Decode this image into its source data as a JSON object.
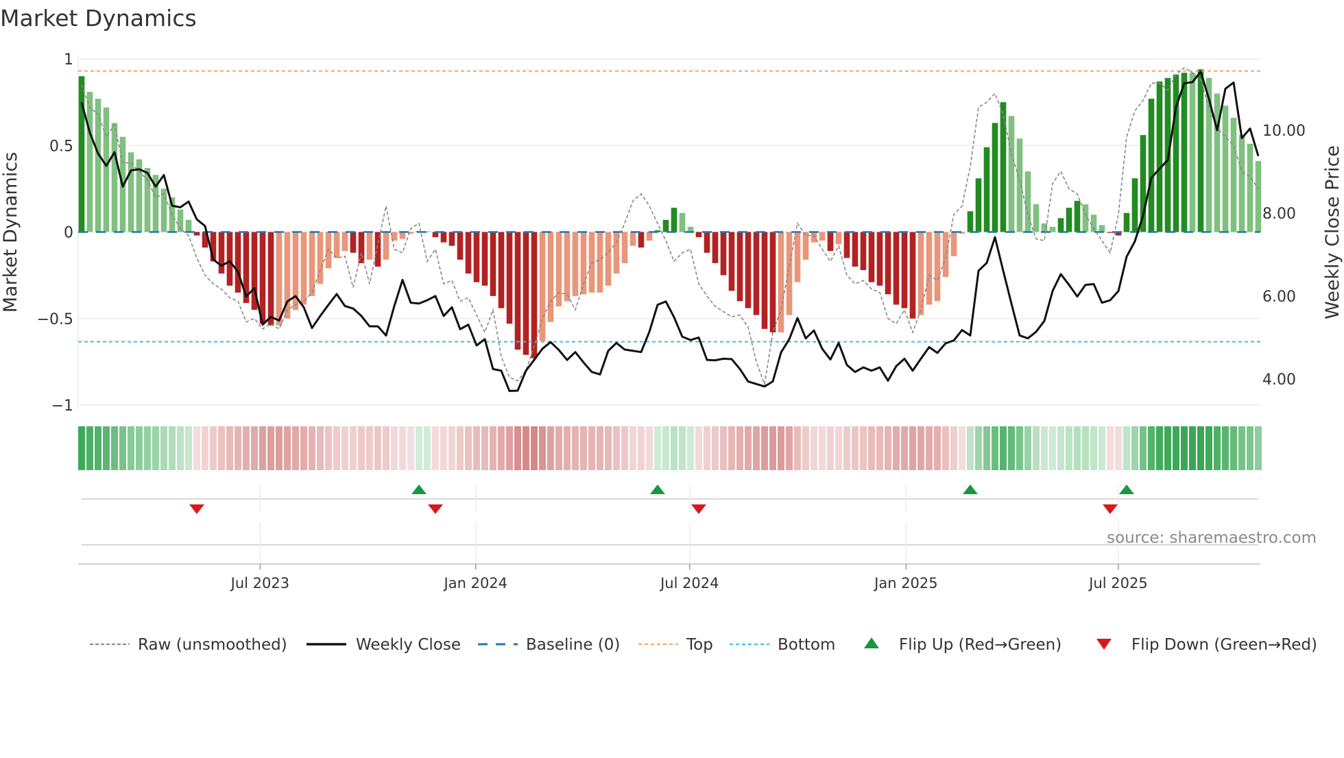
{
  "chart_data": {
    "type": "bar",
    "title": "Market Dynamics",
    "ylabel": "Market Dynamics",
    "ylabel_right": "Weekly Close Price",
    "xlabel": "",
    "ylim": [
      -1,
      1
    ],
    "ylim_right": [
      3.33,
      11.73
    ],
    "yticks": [
      {
        "v": 1,
        "label": "1"
      },
      {
        "v": 0.5,
        "label": "0.5"
      },
      {
        "v": 0,
        "label": "0"
      },
      {
        "v": -0.5,
        "label": "−0.5"
      },
      {
        "v": -1,
        "label": "−1"
      }
    ],
    "yticks_right": [
      {
        "v": 10,
        "label": "10.00"
      },
      {
        "v": 8,
        "label": "8.00"
      },
      {
        "v": 6,
        "label": "6.00"
      },
      {
        "v": 4,
        "label": "4.00"
      }
    ],
    "xticks": [
      {
        "week": 21.7,
        "label": "Jul 2023"
      },
      {
        "week": 47.9,
        "label": "Jan 2024"
      },
      {
        "week": 73.9,
        "label": "Jul 2024"
      },
      {
        "week": 100.2,
        "label": "Jan 2025"
      },
      {
        "week": 126,
        "label": "Jul 2025"
      }
    ],
    "grid": true,
    "top_level": 0.93,
    "bottom_level": -0.634,
    "baseline": 0,
    "series": [
      {
        "name": "Market Dynamics (smoothed)",
        "type": "bar",
        "values": [
          0.9,
          0.81,
          0.77,
          0.72,
          0.63,
          0.55,
          0.46,
          0.42,
          0.37,
          0.33,
          0.25,
          0.2,
          0.13,
          0.07,
          -0.02,
          -0.09,
          -0.17,
          -0.24,
          -0.31,
          -0.35,
          -0.41,
          -0.45,
          -0.53,
          -0.54,
          -0.54,
          -0.5,
          -0.45,
          -0.42,
          -0.37,
          -0.3,
          -0.21,
          -0.15,
          -0.11,
          -0.12,
          -0.18,
          -0.16,
          -0.2,
          -0.16,
          -0.05,
          -0.04,
          -0.01,
          0.005,
          0.004,
          -0.03,
          -0.06,
          -0.08,
          -0.16,
          -0.24,
          -0.29,
          -0.31,
          -0.37,
          -0.44,
          -0.53,
          -0.68,
          -0.71,
          -0.73,
          -0.63,
          -0.52,
          -0.43,
          -0.4,
          -0.37,
          -0.36,
          -0.35,
          -0.35,
          -0.31,
          -0.24,
          -0.18,
          -0.08,
          -0.09,
          -0.05,
          0.01,
          0.07,
          0.14,
          0.11,
          0.03,
          -0.03,
          -0.12,
          -0.18,
          -0.25,
          -0.34,
          -0.4,
          -0.44,
          -0.48,
          -0.56,
          -0.58,
          -0.58,
          -0.48,
          -0.29,
          -0.16,
          -0.06,
          -0.05,
          -0.11,
          -0.07,
          -0.15,
          -0.2,
          -0.22,
          -0.29,
          -0.31,
          -0.36,
          -0.42,
          -0.44,
          -0.5,
          -0.48,
          -0.42,
          -0.4,
          -0.26,
          -0.14,
          -0.01,
          0.12,
          0.31,
          0.49,
          0.63,
          0.75,
          0.67,
          0.54,
          0.35,
          0.16,
          0.05,
          0.03,
          0.08,
          0.14,
          0.18,
          0.16,
          0.1,
          0.04,
          -0.005,
          -0.02,
          0.11,
          0.31,
          0.56,
          0.77,
          0.87,
          0.89,
          0.91,
          0.92,
          0.92,
          0.94,
          0.89,
          0.8,
          0.73,
          0.66,
          0.56,
          0.51,
          0.41
        ]
      },
      {
        "name": "Raw (unsmoothed)",
        "type": "line",
        "values": [
          0.85,
          0.72,
          0.68,
          0.55,
          0.62,
          0.4,
          0.4,
          0.35,
          0.3,
          0.2,
          0.22,
          0.1,
          0.02,
          -0.02,
          -0.15,
          -0.25,
          -0.3,
          -0.33,
          -0.38,
          -0.4,
          -0.52,
          -0.5,
          -0.56,
          -0.53,
          -0.56,
          -0.45,
          -0.42,
          -0.4,
          -0.35,
          -0.22,
          -0.1,
          -0.15,
          -0.14,
          -0.32,
          -0.12,
          -0.3,
          -0.07,
          0.15,
          -0.1,
          -0.12,
          0.02,
          0.05,
          -0.17,
          -0.1,
          -0.3,
          -0.28,
          -0.4,
          -0.38,
          -0.48,
          -0.58,
          -0.45,
          -0.72,
          -0.84,
          -0.86,
          -0.8,
          -0.66,
          -0.5,
          -0.4,
          -0.35,
          -0.36,
          -0.45,
          -0.3,
          -0.18,
          -0.16,
          -0.12,
          -0.06,
          0.05,
          0.18,
          0.22,
          0.15,
          0.05,
          -0.05,
          -0.17,
          -0.12,
          -0.1,
          -0.3,
          -0.37,
          -0.43,
          -0.46,
          -0.49,
          -0.48,
          -0.55,
          -0.75,
          -0.88,
          -0.58,
          -0.45,
          -0.2,
          0.05,
          -0.02,
          -0.02,
          -0.1,
          -0.17,
          -0.08,
          -0.25,
          -0.3,
          -0.28,
          -0.33,
          -0.35,
          -0.5,
          -0.53,
          -0.45,
          -0.58,
          -0.45,
          -0.25,
          -0.28,
          -0.15,
          0.1,
          0.15,
          0.38,
          0.72,
          0.75,
          0.8,
          0.68,
          0.45,
          0.3,
          0.1,
          -0.04,
          -0.05,
          0.28,
          0.35,
          0.25,
          0.22,
          0.1,
          0.02,
          -0.05,
          -0.12,
          0.1,
          0.55,
          0.7,
          0.76,
          0.86,
          0.86,
          0.82,
          0.91,
          0.95,
          0.92,
          0.88,
          0.72,
          0.6,
          0.55,
          0.5,
          0.35,
          0.32,
          0.25
        ]
      },
      {
        "name": "Weekly Close",
        "type": "line",
        "axis": "right",
        "values": [
          10.67,
          9.94,
          9.44,
          9.14,
          9.47,
          8.64,
          9.03,
          9.06,
          8.97,
          8.64,
          8.92,
          8.18,
          8.14,
          8.28,
          7.85,
          7.69,
          6.88,
          6.73,
          6.84,
          6.59,
          5.99,
          6.19,
          5.31,
          5.5,
          5.41,
          5.87,
          6.0,
          5.73,
          5.23,
          5.52,
          5.79,
          6.05,
          5.76,
          5.7,
          5.52,
          5.27,
          5.27,
          5.05,
          5.76,
          6.39,
          5.84,
          5.82,
          5.9,
          6.0,
          5.52,
          5.73,
          5.2,
          5.31,
          4.81,
          4.96,
          4.24,
          4.2,
          3.71,
          3.72,
          4.2,
          4.46,
          4.73,
          4.89,
          4.7,
          4.46,
          4.65,
          4.4,
          4.17,
          4.11,
          4.68,
          4.87,
          4.71,
          4.68,
          4.65,
          5.14,
          5.79,
          5.87,
          5.49,
          5.02,
          4.94,
          5.0,
          4.46,
          4.45,
          4.49,
          4.48,
          4.24,
          3.94,
          3.88,
          3.82,
          3.94,
          4.64,
          4.96,
          5.47,
          4.98,
          5.17,
          4.73,
          4.47,
          4.87,
          4.34,
          4.17,
          4.28,
          4.2,
          4.28,
          3.96,
          4.31,
          4.49,
          4.2,
          4.49,
          4.77,
          4.63,
          4.86,
          4.93,
          5.18,
          5.05,
          6.61,
          6.8,
          7.42,
          6.61,
          5.82,
          5.05,
          4.98,
          5.14,
          5.4,
          6.12,
          6.53,
          6.27,
          5.99,
          6.27,
          6.29,
          5.84,
          5.9,
          6.12,
          6.95,
          7.32,
          7.94,
          8.85,
          9.07,
          9.28,
          10.56,
          11.13,
          11.16,
          11.41,
          10.76,
          10.0,
          11.0,
          11.15,
          9.81,
          10.04,
          9.38
        ]
      }
    ],
    "flip_up_weeks": [
      41,
      70,
      108,
      127
    ],
    "flip_down_weeks": [
      14,
      43,
      75,
      125
    ],
    "colors": {
      "bar_pos_rising": "#228b22",
      "bar_pos_falling": "#80c080",
      "bar_neg_falling": "#b22222",
      "bar_neg_rising": "#e9967a",
      "raw": "#888888",
      "close": "#111111",
      "baseline": "#1f77b4",
      "top": "#f4a460",
      "bottom": "#33c3d6",
      "flip_up": "#1a9641",
      "flip_down": "#d7191c"
    },
    "legend": {
      "position": "bottom",
      "items": [
        {
          "key": "raw",
          "label": "Raw (unsmoothed)"
        },
        {
          "key": "close",
          "label": "Weekly Close"
        },
        {
          "key": "baseline",
          "label": "Baseline (0)"
        },
        {
          "key": "top",
          "label": "Top"
        },
        {
          "key": "bottom",
          "label": "Bottom"
        },
        {
          "key": "flip_up",
          "label": "Flip Up (Red→Green)"
        },
        {
          "key": "flip_down",
          "label": "Flip Down (Green→Red)"
        }
      ]
    },
    "source": "source: sharemaestro.com"
  }
}
